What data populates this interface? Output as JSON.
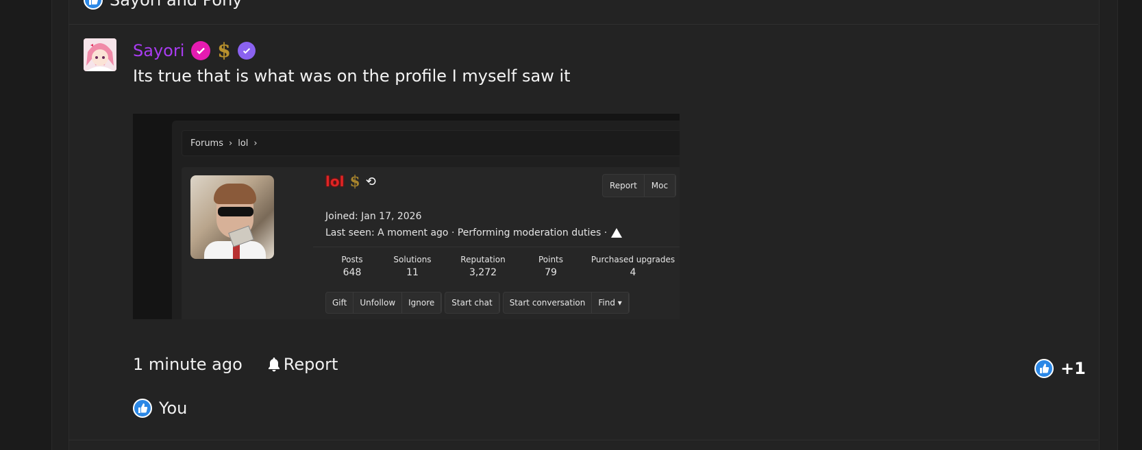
{
  "previous_post": {
    "reaction_users": "Sayori and Pony"
  },
  "post": {
    "username": "Sayori",
    "message": "Its true that is what was on the profile I myself saw it",
    "time": "1 minute ago",
    "report_label": "Report",
    "reaction_score": "+1",
    "liked_by": "You"
  },
  "embedded_screenshot": {
    "breadcrumbs": [
      "Forums",
      "lol"
    ],
    "profile_name": "lol",
    "actions": [
      "Report",
      "Moc"
    ],
    "joined": "Joined: Jan 17, 2026",
    "last_seen": "Last seen: A moment ago · Performing moderation duties ·",
    "stats": [
      {
        "label": "Posts",
        "value": "648"
      },
      {
        "label": "Solutions",
        "value": "11"
      },
      {
        "label": "Reputation",
        "value": "3,272"
      },
      {
        "label": "Points",
        "value": "79"
      },
      {
        "label": "Purchased upgrades",
        "value": "4"
      }
    ],
    "buttons_group1": [
      "Gift",
      "Unfollow",
      "Ignore"
    ],
    "buttons_group2": [
      "Start chat"
    ],
    "buttons_group3": [
      "Start conversation",
      "Find ▾"
    ]
  },
  "colors": {
    "username": "#a83cf0",
    "like_blue": "#2c88e6",
    "badge_pink": "#e51bb1",
    "badge_purple": "#8a62f0"
  },
  "icons": {
    "like": "thumbs-up-icon",
    "verified": "check-badge-icon",
    "dollar": "dollar-badge-icon",
    "bell": "bell-icon",
    "history": "history-icon",
    "warning": "warning-icon"
  }
}
